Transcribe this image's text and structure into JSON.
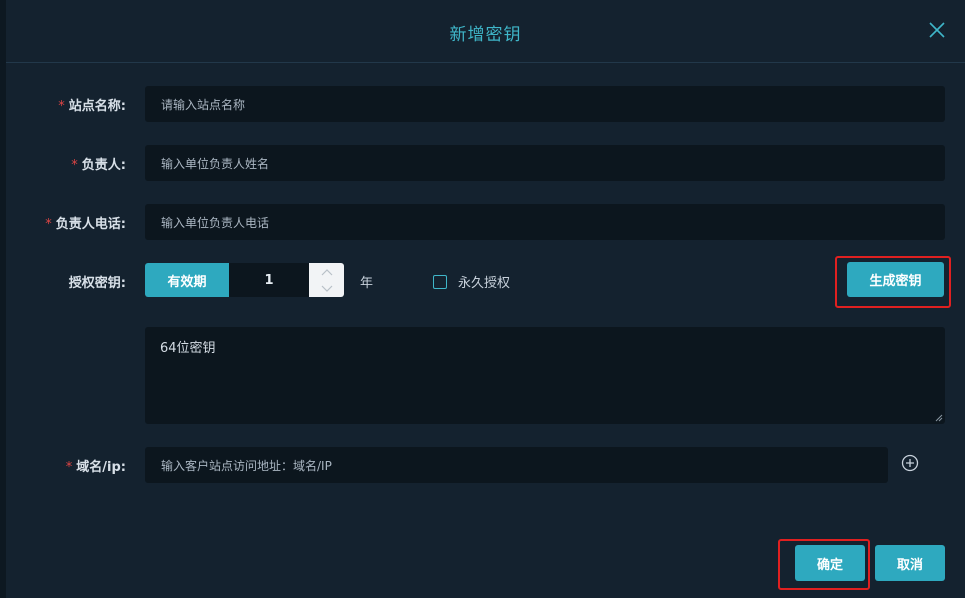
{
  "dialog": {
    "title": "新增密钥",
    "close_icon": "close-icon"
  },
  "form": {
    "site_name": {
      "label": "站点名称:",
      "required": "*",
      "placeholder": "请输入站点名称"
    },
    "owner": {
      "label": "负责人:",
      "required": "*",
      "placeholder": "输入单位负责人姓名"
    },
    "owner_phone": {
      "label": "负责人电话:",
      "required": "*",
      "placeholder": "输入单位负责人电话"
    },
    "auth_key": {
      "label": "授权密钥:",
      "validity_label": "有效期",
      "years_value": "1",
      "unit": "年",
      "permanent_label": "永久授权",
      "permanent_checked": false,
      "generate_button": "生成密钥",
      "key_placeholder": "64位密钥"
    },
    "domain": {
      "label": "域名/ip:",
      "required": "*",
      "placeholder": "输入客户站点访问地址：域名/IP",
      "add_icon": "plus-circle-icon"
    }
  },
  "footer": {
    "confirm_button": "确定",
    "cancel_button": "取消"
  },
  "colors": {
    "accent": "#2ea9bf",
    "title": "#3fb6c9",
    "required": "#e04545",
    "highlight": "#e02020",
    "background": "#14222f",
    "input_bg": "#0c161e"
  }
}
